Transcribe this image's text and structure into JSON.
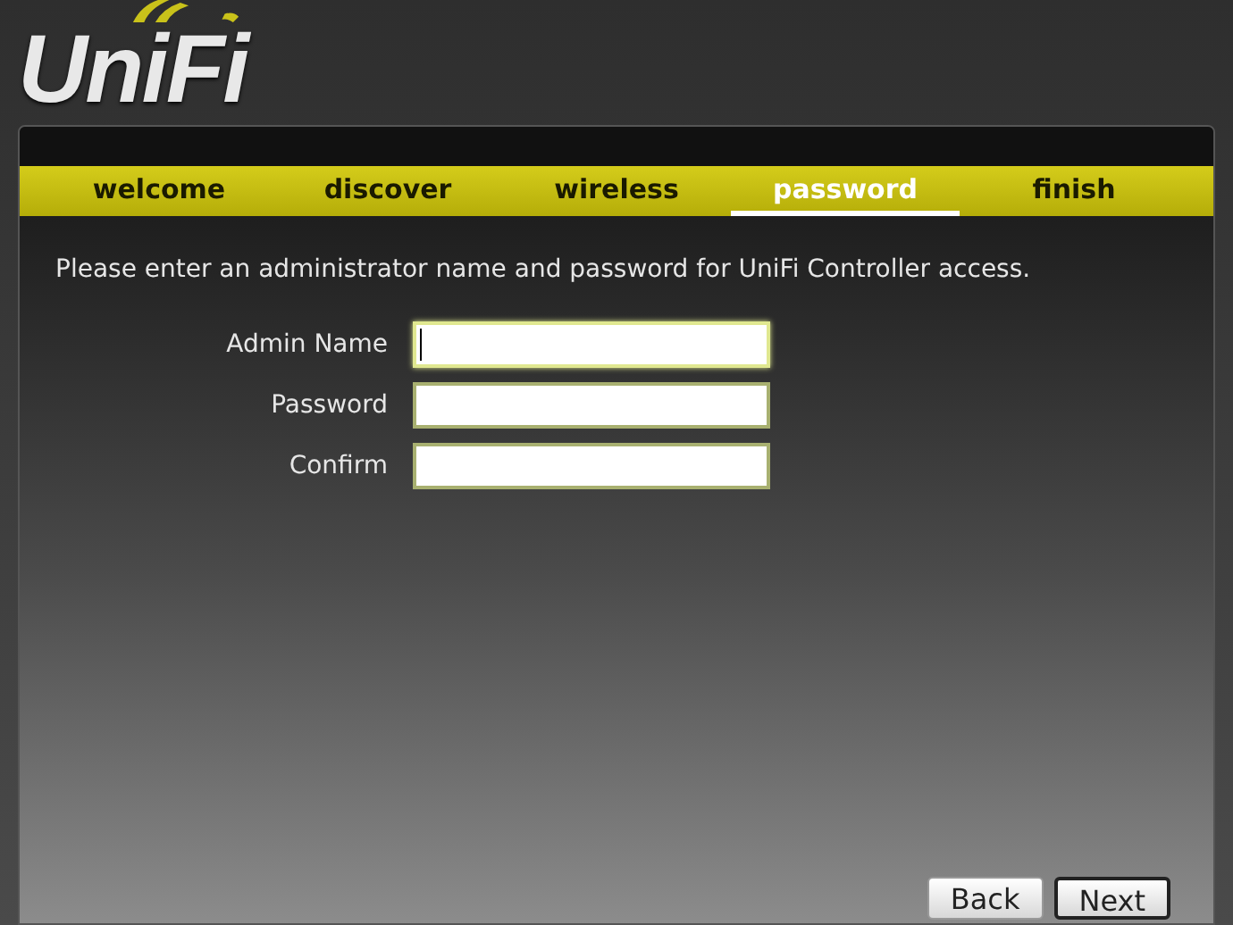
{
  "logo": {
    "text": "UniFi"
  },
  "tabs": [
    {
      "label": "welcome",
      "selected": false
    },
    {
      "label": "discover",
      "selected": false
    },
    {
      "label": "wireless",
      "selected": false
    },
    {
      "label": "password",
      "selected": true
    },
    {
      "label": "finish",
      "selected": false
    }
  ],
  "instructions": "Please enter an administrator name and password for UniFi Controller access.",
  "fields": [
    {
      "label": "Admin Name",
      "focused": true
    },
    {
      "label": "Password",
      "focused": false
    },
    {
      "label": "Confirm",
      "focused": false
    }
  ],
  "buttons": [
    {
      "label": "Back",
      "default": false
    },
    {
      "label": "Next",
      "default": true
    }
  ]
}
